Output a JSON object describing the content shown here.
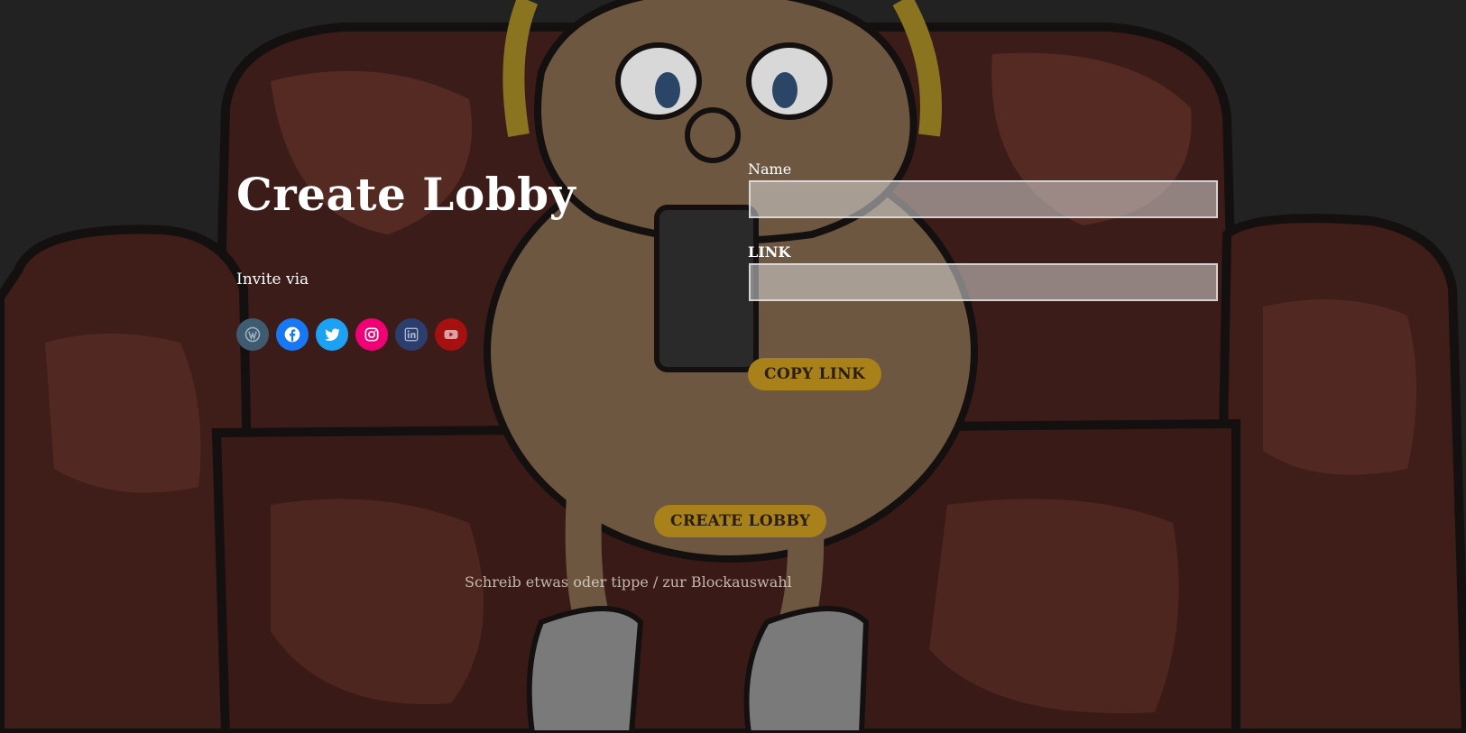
{
  "page": {
    "title": "Create Lobby",
    "invite_label": "Invite via"
  },
  "social_links": [
    {
      "name": "wordpress",
      "icon": "wordpress-icon",
      "color": "#3f5b70"
    },
    {
      "name": "facebook",
      "icon": "facebook-icon",
      "color": "#1877f2"
    },
    {
      "name": "twitter",
      "icon": "twitter-icon",
      "color": "#1da1f2"
    },
    {
      "name": "instagram",
      "icon": "instagram-icon",
      "color": "#f00075"
    },
    {
      "name": "linkedin",
      "icon": "linkedin-icon",
      "color": "#2c3e6e"
    },
    {
      "name": "youtube",
      "icon": "youtube-icon",
      "color": "#a51010"
    }
  ],
  "form": {
    "name_label": "Name",
    "name_value": "",
    "link_label": "LINK",
    "link_value": "",
    "copy_link_label": "COPY LINK"
  },
  "actions": {
    "create_lobby_label": "CREATE LOBBY"
  },
  "editor": {
    "block_placeholder": "Schreib etwas oder tippe / zur Blockauswahl"
  },
  "colors": {
    "background": "#222222",
    "button": "#a8811a",
    "button_text": "#2a1e0e",
    "text": "#ffffff"
  }
}
